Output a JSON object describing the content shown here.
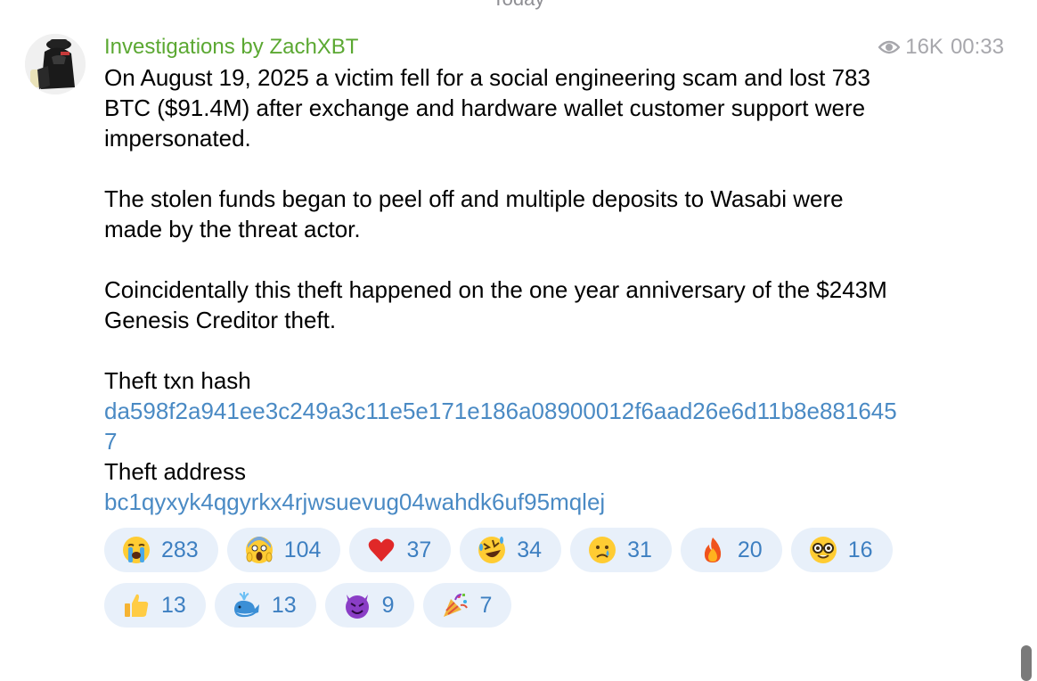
{
  "date_header": "Today",
  "message": {
    "sender": "Investigations by ZachXBT",
    "views": "16K",
    "time": "00:33",
    "paragraphs": [
      "On August 19, 2025 a victim fell for a social engineering scam and lost 783 BTC ($91.4M) after exchange and hardware wallet customer support were impersonated.",
      "",
      "The stolen funds began to peel off and multiple deposits to Wasabi were made by the threat actor.",
      "",
      "Coincidentally this theft happened on the one year anniversary of the $243M Genesis Creditor theft.",
      ""
    ],
    "hash_label": "Theft txn hash",
    "hash_value": "da598f2a941ee3c249a3c11e5e171e186a08900012f6aad26e6d11b8e8816457",
    "address_label": "Theft address",
    "address_value": "bc1qyxyk4qgyrkx4rjwsuevug04wahdk6uf95mqlej"
  },
  "reactions": [
    {
      "emoji": "loudly-crying-face-icon",
      "count": "283"
    },
    {
      "emoji": "face-screaming-in-fear-icon",
      "count": "104"
    },
    {
      "emoji": "red-heart-icon",
      "count": "37"
    },
    {
      "emoji": "rolling-on-floor-laughing-icon",
      "count": "34"
    },
    {
      "emoji": "crying-face-icon",
      "count": "31"
    },
    {
      "emoji": "fire-icon",
      "count": "20"
    },
    {
      "emoji": "nerd-face-icon",
      "count": "16"
    },
    {
      "emoji": "thumbs-up-icon",
      "count": "13"
    },
    {
      "emoji": "spouting-whale-icon",
      "count": "13"
    },
    {
      "emoji": "smiling-devil-icon",
      "count": "9"
    },
    {
      "emoji": "party-popper-icon",
      "count": "7"
    }
  ],
  "colors": {
    "sender": "#5ba832",
    "link": "#4a8ac4",
    "reaction_bg": "#e8f0fa",
    "reaction_text": "#3d7fc1",
    "meta": "#a7a7ac"
  }
}
